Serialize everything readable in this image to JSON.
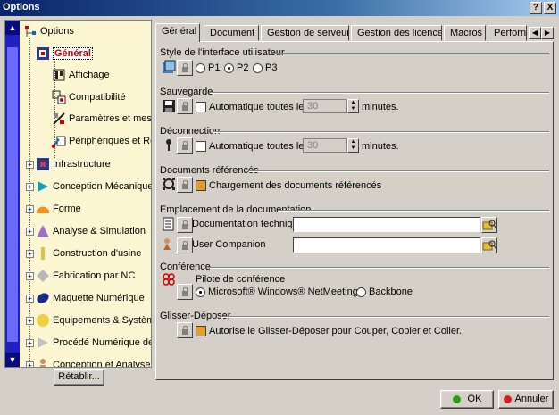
{
  "window": {
    "title": "Options",
    "help_btn": "?",
    "close_btn": "X"
  },
  "tree": {
    "root": "Options",
    "items": [
      {
        "label": "Général",
        "selected": true
      },
      {
        "label": "Affichage"
      },
      {
        "label": "Compatibilité"
      },
      {
        "label": "Paramètres et mesure"
      },
      {
        "label": "Périphériques et Réalit"
      },
      {
        "label": "Infrastructure"
      },
      {
        "label": "Conception Mécanique"
      },
      {
        "label": "Forme"
      },
      {
        "label": "Analyse & Simulation"
      },
      {
        "label": "Construction d'usine"
      },
      {
        "label": "Fabrication par NC"
      },
      {
        "label": "Maquette Numérique"
      },
      {
        "label": "Equipements & Systèmes"
      },
      {
        "label": "Procédé Numérique de Fal"
      },
      {
        "label": "Conception et Analyse Erc"
      }
    ]
  },
  "reset_button": "Rétablir...",
  "tabs": [
    "Général",
    "Document",
    "Gestion de serveur",
    "Gestion des licences",
    "Macros",
    "Perforn"
  ],
  "sections": {
    "ui_style": {
      "title": "Style de l'interface utilisateur",
      "options": [
        "P1",
        "P2",
        "P3"
      ],
      "selected": "P2"
    },
    "save": {
      "title": "Sauvegarde",
      "checkbox_label": "Automatique toutes les",
      "value": "30",
      "unit": "minutes."
    },
    "disconnect": {
      "title": "Déconnection",
      "checkbox_label": "Automatique toutes les",
      "value": "30",
      "unit": "minutes."
    },
    "ref_docs": {
      "title": "Documents référencés",
      "checkbox_label": "Chargement des documents référencés"
    },
    "doc_location": {
      "title": "Emplacement de la documentation",
      "tech_doc_label": "Documentation technique",
      "user_companion_label": "User Companion"
    },
    "conference": {
      "title": "Conférence",
      "driver_label": "Pilote de conférence",
      "options": [
        "Microsoft® Windows® NetMeeting®",
        "Backbone"
      ],
      "selected": "Microsoft® Windows® NetMeeting®"
    },
    "drag_drop": {
      "title": "Glisser-Déposer",
      "checkbox_label": "Autorise le Glisser-Déposer pour Couper, Copier et Coller."
    }
  },
  "buttons": {
    "ok": "OK",
    "cancel": "Annuler"
  }
}
